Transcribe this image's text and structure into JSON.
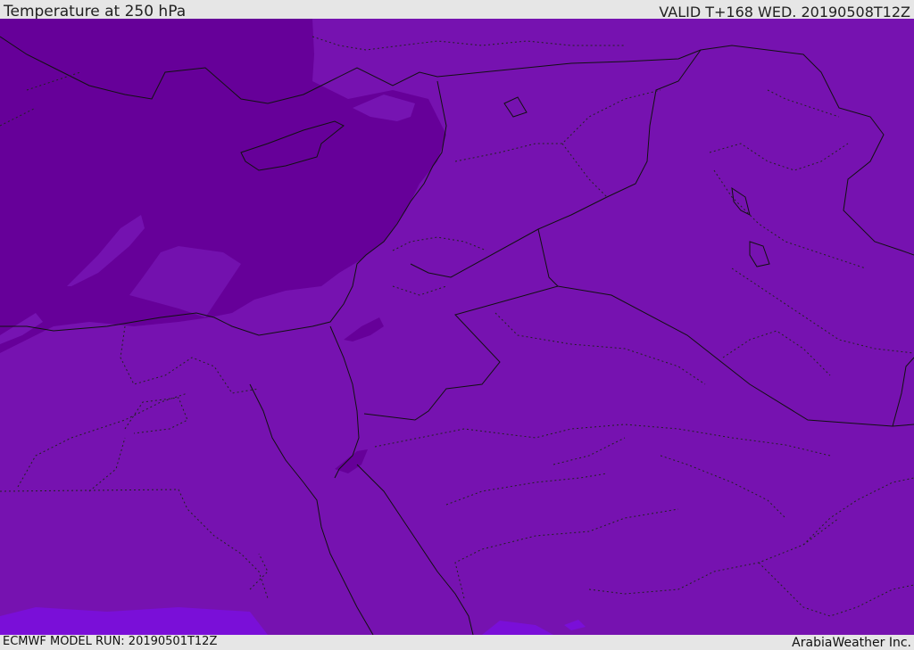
{
  "header": {
    "title": "Temperature at 250 hPa",
    "valid": "VALID T+168 WED. 20190508T12Z"
  },
  "footer": {
    "model_run": "ECMWF MODEL RUN: 20190501T12Z",
    "credit": "ArabiaWeather Inc."
  },
  "map": {
    "colors": {
      "base": "#7612b0",
      "cold_core": "#660099",
      "mid_band": "#7614b2",
      "warm_south": "#7a0fd8",
      "border": "#111111"
    }
  }
}
